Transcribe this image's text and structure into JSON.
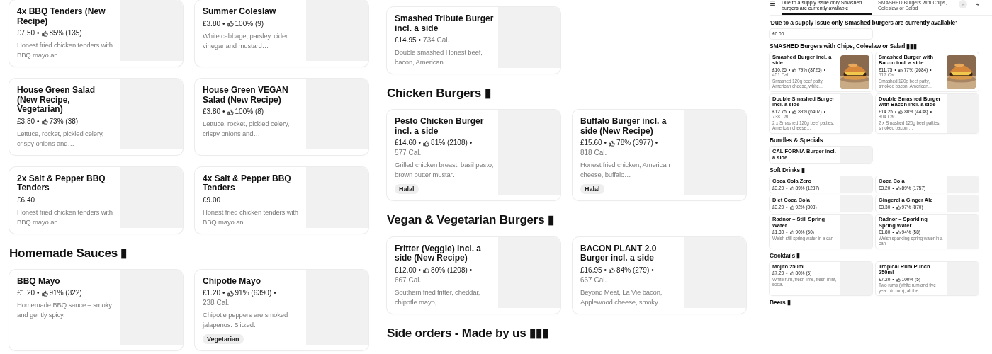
{
  "separator": "•",
  "panels": [
    {
      "sections": [
        {
          "items": [
            {
              "name": "4x BBQ Tenders (New Recipe)",
              "price": "£7.50",
              "rating": "85% (135)",
              "description": "Honest fried chicken tenders with BBQ mayo an…",
              "kind": "blank"
            },
            {
              "name": "Summer Coleslaw",
              "price": "£3.80",
              "rating": "100% (9)",
              "description": "White cabbage, parsley, cider vinegar and mustard…",
              "kind": "blank"
            },
            {
              "name": "House Green Salad (New Recipe, Vegetarian)",
              "price": "£3.80",
              "rating": "73% (38)",
              "description": "Lettuce, rocket, pickled celery, crispy onions and…",
              "kind": "blank"
            },
            {
              "name": "House Green VEGAN Salad (New Recipe)",
              "price": "£3.80",
              "rating": "100% (8)",
              "description": "Lettuce, rocket, pickled celery, crispy onions and…",
              "kind": "blank"
            },
            {
              "name": "2x Salt & Pepper BBQ Tenders",
              "price": "£6.40",
              "description": "Honest fried chicken tenders with BBQ mayo an…",
              "kind": "blank"
            },
            {
              "name": "4x Salt & Pepper BBQ Tenders",
              "price": "£9.00",
              "description": "Honest fried chicken tenders with BBQ mayo an…",
              "kind": "blank"
            }
          ]
        },
        {
          "heading": "Homemade Sauces ▮",
          "items": [
            {
              "name": "BBQ Mayo",
              "price": "£1.20",
              "rating": "91% (322)",
              "description": "Homemade BBQ sauce – smoky and gently spicy.",
              "kind": "blank"
            },
            {
              "name": "Chipotle Mayo",
              "price": "£1.20",
              "rating": "91% (6390)",
              "calories": "238 Cal.",
              "description": "Chipotle peppers are smoked jalapenos. Blitzed…",
              "tag": "Vegetarian",
              "kind": "blank"
            }
          ]
        }
      ]
    },
    {
      "sections": [
        {
          "items": [
            {
              "name": "Smashed Tribute Burger incl. a side",
              "price": "£14.95",
              "calories": "734 Cal.",
              "description": "Double smashed Honest beef, bacon, American…",
              "kind": "blank"
            }
          ]
        },
        {
          "heading": "Chicken Burgers ▮",
          "items": [
            {
              "name": "Pesto Chicken Burger incl. a side",
              "price": "£14.60",
              "rating": "81% (2108)",
              "calories": "577 Cal.",
              "description": "Grilled chicken breast, basil pesto, brown butter mustar…",
              "tag": "Halal",
              "kind": "blank"
            },
            {
              "name": "Buffalo Burger incl. a side (New Recipe)",
              "price": "£15.60",
              "rating": "78% (3977)",
              "calories": "818 Cal.",
              "description": "Honest fried chicken, American cheese, buffalo…",
              "tag": "Halal",
              "kind": "blank"
            }
          ]
        },
        {
          "heading": "Vegan & Vegetarian Burgers ▮",
          "items": [
            {
              "name": "Fritter (Veggie) incl. a side (New Recipe)",
              "price": "£12.00",
              "rating": "80% (1208)",
              "calories": "667 Cal.",
              "description": "Southern fried fritter, cheddar, chipotle mayo,…",
              "kind": "blank"
            },
            {
              "name": "BACON PLANT 2.0 Burger incl. a side",
              "price": "£16.95",
              "rating": "84% (279)",
              "calories": "667 Cal.",
              "description": "Beyond Meat, La Vie bacon, Applewood cheese, smoky…",
              "kind": "blank"
            }
          ]
        },
        {
          "heading": "Side orders - Made by us ▮▮▮"
        }
      ]
    },
    {
      "tabs": [
        {
          "label": "Due to a supply issue only Smashed burgers are currently available",
          "selected": true
        },
        {
          "label": "SMASHED Burgers with Chips, Coleslaw or Salad",
          "selected": false
        }
      ],
      "sections": [
        {
          "heading": "'Due to a supply issue only Smashed burgers are currently available'",
          "items": [
            {
              "price": "£0.00",
              "kind": "plain"
            }
          ]
        },
        {
          "heading": "SMASHED Burgers with Chips, Coleslaw or Salad ▮▮▮",
          "items": [
            {
              "name": "Smashed Burger incl. a side",
              "price": "£10.25",
              "rating": "79% (8725)",
              "calories": "451 Cal.",
              "description": "Smashed 120g beef patty, American cheese, white…"
            },
            {
              "name": "Smashed Burger with Bacon incl. a side",
              "price": "£11.75",
              "rating": "77% (2684)",
              "calories": "517 Cal.",
              "description": "Smashed 120g beef patty, smoked bacon, American…"
            },
            {
              "name": "Double Smashed Burger incl. a side",
              "price": "£12.75",
              "rating": "83% (6407)",
              "calories": "738 Cal.",
              "description": "2 x Smashed 120g beef patties, American cheese…",
              "kind": "blank"
            },
            {
              "name": "Double Smashed Burger with Bacon incl. a side",
              "price": "£14.25",
              "rating": "80% (4438)",
              "calories": "804 Cal.",
              "description": "2 x Smashed 120g beef patties, smoked bacon,…",
              "kind": "blank"
            }
          ]
        },
        {
          "heading": "Bundles & Specials",
          "items": [
            {
              "name": "CALIFORNIA Burger incl. a side",
              "kind": "blank"
            }
          ]
        },
        {
          "heading": "Soft Drinks ▮",
          "items": [
            {
              "name": "Coca Cola Zero",
              "price": "£3.20",
              "rating": "89% (1287)",
              "kind": "blank"
            },
            {
              "name": "Coca Cola",
              "price": "£3.20",
              "rating": "89% (1757)",
              "kind": "blank"
            },
            {
              "name": "Diet Coca Cola",
              "price": "£3.20",
              "rating": "92% (808)",
              "kind": "blank"
            },
            {
              "name": "Gingerella Ginger Ale",
              "price": "£3.30",
              "rating": "97% (870)",
              "kind": "blank"
            },
            {
              "name": "Radnor – Still Spring Water",
              "price": "£1.80",
              "rating": "90% (50)",
              "description": "Welsh still spring water in a can",
              "kind": "blank"
            },
            {
              "name": "Radnor – Sparkling Spring Water",
              "price": "£1.80",
              "rating": "94% (58)",
              "description": "Welsh sparkling spring water in a can",
              "kind": "blank"
            }
          ]
        },
        {
          "heading": "Cocktails ▮",
          "items": [
            {
              "name": "Mojito 250ml",
              "price": "£7.20",
              "rating": "80% (5)",
              "description": "White rum, fresh lime, fresh mint, soda.",
              "kind": "blank"
            },
            {
              "name": "Tropical Rum Punch 250ml",
              "price": "£7.20",
              "rating": "100% (5)",
              "description": "Two rums (white rum and five year old rum), all the…",
              "kind": "blank"
            }
          ]
        },
        {
          "heading": "Beers ▮"
        }
      ]
    }
  ]
}
